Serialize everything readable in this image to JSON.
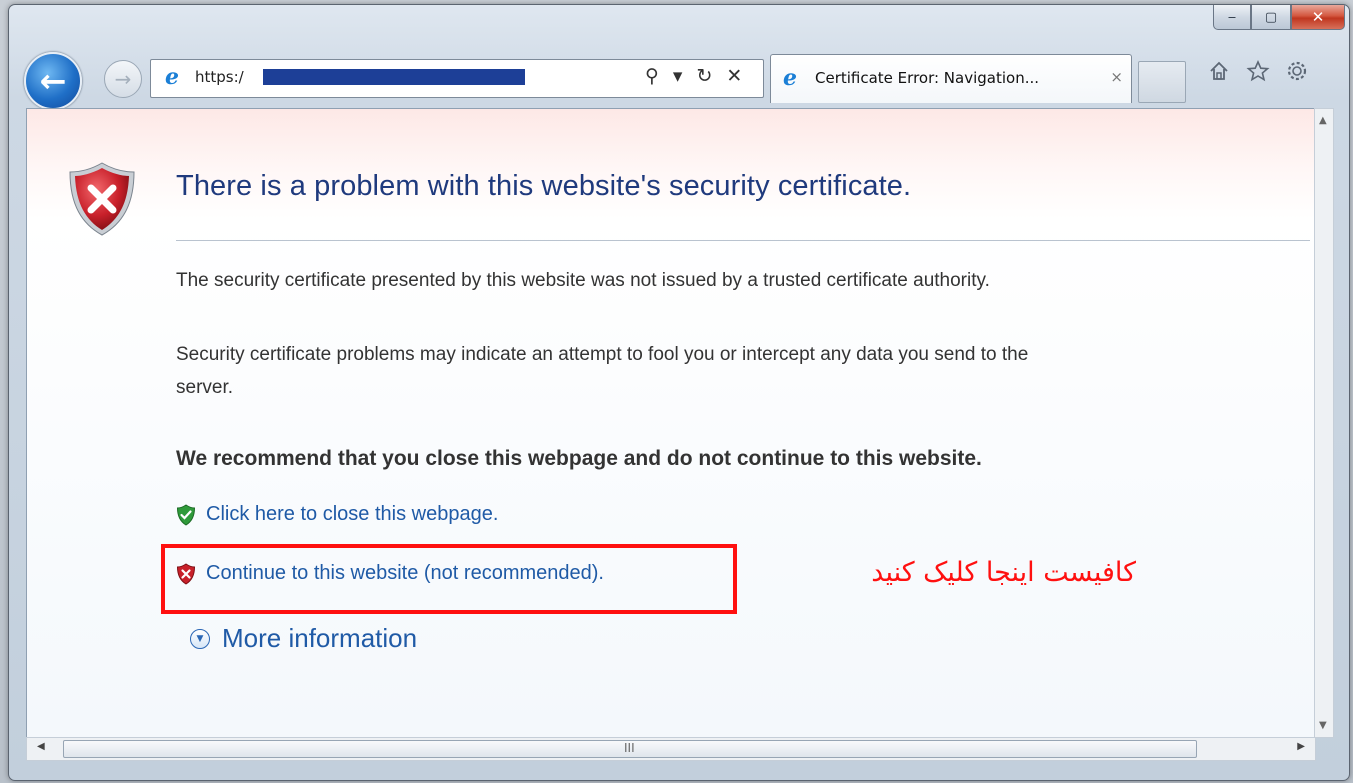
{
  "window": {
    "caption_buttons": {
      "minimize": "‒",
      "maximize": "▢",
      "close": "✕"
    }
  },
  "nav": {
    "back_glyph": "←",
    "forward_glyph": "→",
    "address": {
      "prefix": "https:/",
      "tools": [
        "⚲",
        "▾",
        "↻",
        "✕"
      ]
    },
    "tab": {
      "title": "Certificate Error: Navigation...",
      "close": "×"
    },
    "toolbar_icons": [
      "home-icon",
      "favorites-star-icon",
      "settings-gear-icon"
    ]
  },
  "page": {
    "heading": "There is a problem with this website's security certificate.",
    "paragraph_1": "The security certificate presented by this website was not issued by a trusted certificate authority.",
    "paragraph_2_line_1": "Security certificate problems may indicate an attempt to fool you or intercept any data you send to the",
    "paragraph_2_line_2": "server.",
    "recommendation": "We recommend that you close this webpage and do not continue to this website.",
    "close_link": "Click here to close this webpage.",
    "continue_link": "Continue to this website (not recommended).",
    "more_info": "More information"
  },
  "annotation": {
    "text": "کافیست اینجا کلیک کنید",
    "color": "#ff1010"
  },
  "scrollbar": {
    "grip": "III"
  },
  "colors": {
    "link": "#1f5aa6",
    "heading": "#1f3a7d",
    "shield_red": "#c8202a",
    "shield_green": "#2f9a3a"
  }
}
